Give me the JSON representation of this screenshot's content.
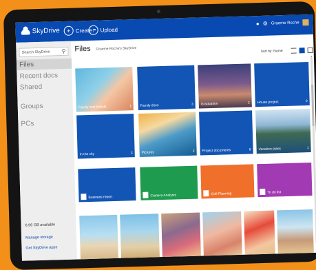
{
  "app": {
    "name": "SkyDrive"
  },
  "toolbar": {
    "create_label": "Create",
    "upload_label": "Upload"
  },
  "user": {
    "name": "Graeme Roche"
  },
  "sidebar": {
    "search_placeholder": "Search SkyDrive",
    "items": [
      "Files",
      "Recent docs",
      "Shared",
      "Groups",
      "PCs"
    ],
    "storage": "6.96 GB available",
    "manage": "Manage storage",
    "apps": "Get SkyDrive apps"
  },
  "main": {
    "title": "Files",
    "breadcrumb": "Graeme Roche's SkyDrive",
    "sort": "Sort by: Name",
    "folders": [
      {
        "label": "Family and friends",
        "count": "1"
      },
      {
        "label": "Family docs",
        "count": "3"
      },
      {
        "label": "Graduation",
        "count": "2"
      },
      {
        "label": "House project",
        "count": "0"
      },
      {
        "label": "In the city",
        "count": "3"
      },
      {
        "label": "Pictures",
        "count": "2"
      },
      {
        "label": "Project documents",
        "count": "6"
      },
      {
        "label": "Vacation plans",
        "count": "1"
      }
    ],
    "docs": [
      "Business report",
      "Camera Analysis",
      "Golf Planning",
      "To do list"
    ]
  },
  "colors": {
    "accent": "#094ab2",
    "folder": "#1255b4",
    "excel": "#1e9b4e",
    "powerpoint": "#f0702b",
    "onenote": "#a23ab3",
    "background": "#f39019"
  }
}
